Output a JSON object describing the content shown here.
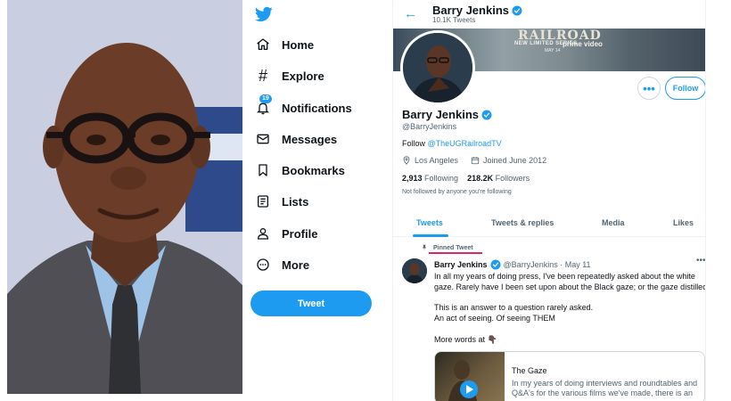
{
  "nav": {
    "items": [
      {
        "label": "Home",
        "icon": "home-icon"
      },
      {
        "label": "Explore",
        "icon": "hashtag-icon"
      },
      {
        "label": "Notifications",
        "icon": "bell-icon",
        "badge": "19"
      },
      {
        "label": "Messages",
        "icon": "envelope-icon"
      },
      {
        "label": "Bookmarks",
        "icon": "bookmark-icon"
      },
      {
        "label": "Lists",
        "icon": "list-icon"
      },
      {
        "label": "Profile",
        "icon": "person-icon"
      },
      {
        "label": "More",
        "icon": "more-circle-icon"
      }
    ],
    "tweet_button": "Tweet"
  },
  "header": {
    "name": "Barry Jenkins",
    "tweet_count": "10.1K Tweets"
  },
  "banner": {
    "title": "RAILROAD",
    "series_line": "NEW LIMITED SERIES",
    "date_line": "MAY 14",
    "network": "prime video"
  },
  "profile": {
    "name": "Barry Jenkins",
    "handle": "@BarryJenkins",
    "bio_prefix": "Follow ",
    "bio_link": "@TheUGRailroadTV",
    "location": "Los Angeles",
    "joined": "Joined June 2012",
    "following_count": "2,913",
    "following_label": "Following",
    "followers_count": "218.2K",
    "followers_label": "Followers",
    "follow_note": "Not followed by anyone you're following",
    "more_label": "•••",
    "follow_label": "Follow"
  },
  "tabs": [
    "Tweets",
    "Tweets & replies",
    "Media",
    "Likes"
  ],
  "tweet": {
    "pinned_label": "Pinned Tweet",
    "author": "Barry Jenkins",
    "handle_date": "@BarryJenkins · May 11",
    "more": "•••",
    "lines": [
      "In all my years of doing press, I've been repeatedly asked about the white",
      "gaze. Rarely have I been set upon about the Black gaze; or the gaze distilled.",
      "",
      "This is an answer to a question rarely asked.",
      "An act of seeing. Of seeing THEM",
      "",
      "More words at 👇🏿"
    ],
    "card_title": "The Gaze",
    "card_description": "In my years of doing interviews and roundtables and Q&A's for the various films we've made, there is an"
  },
  "colors": {
    "accent": "#1d9bf0",
    "text": "#0f1419",
    "secondary": "#536471",
    "annotation": "#e0245e"
  }
}
